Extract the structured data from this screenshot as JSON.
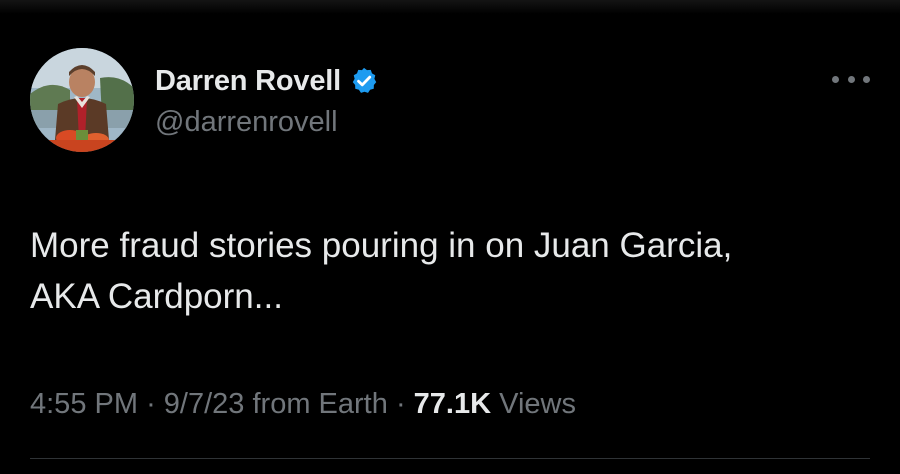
{
  "author": {
    "display_name": "Darren Rovell",
    "handle": "@darrenrovell",
    "verified_badge_icon": "verified-check-icon",
    "avatar_icon": "avatar-photo"
  },
  "tweet": {
    "text_lines": [
      "More fraud stories pouring in on Juan Garcia,",
      "AKA Cardporn..."
    ]
  },
  "meta": {
    "time": "4:55 PM",
    "separator": "·",
    "date": "9/7/23",
    "source": "from Earth",
    "views_count": "77.1K",
    "views_label": "Views"
  },
  "colors": {
    "background": "#000000",
    "primary_text": "#e7e9ea",
    "secondary_text": "#71767b",
    "verified_blue": "#1d9bf0",
    "divider": "#2f3336"
  },
  "icons": {
    "more": "more-dots-icon"
  }
}
